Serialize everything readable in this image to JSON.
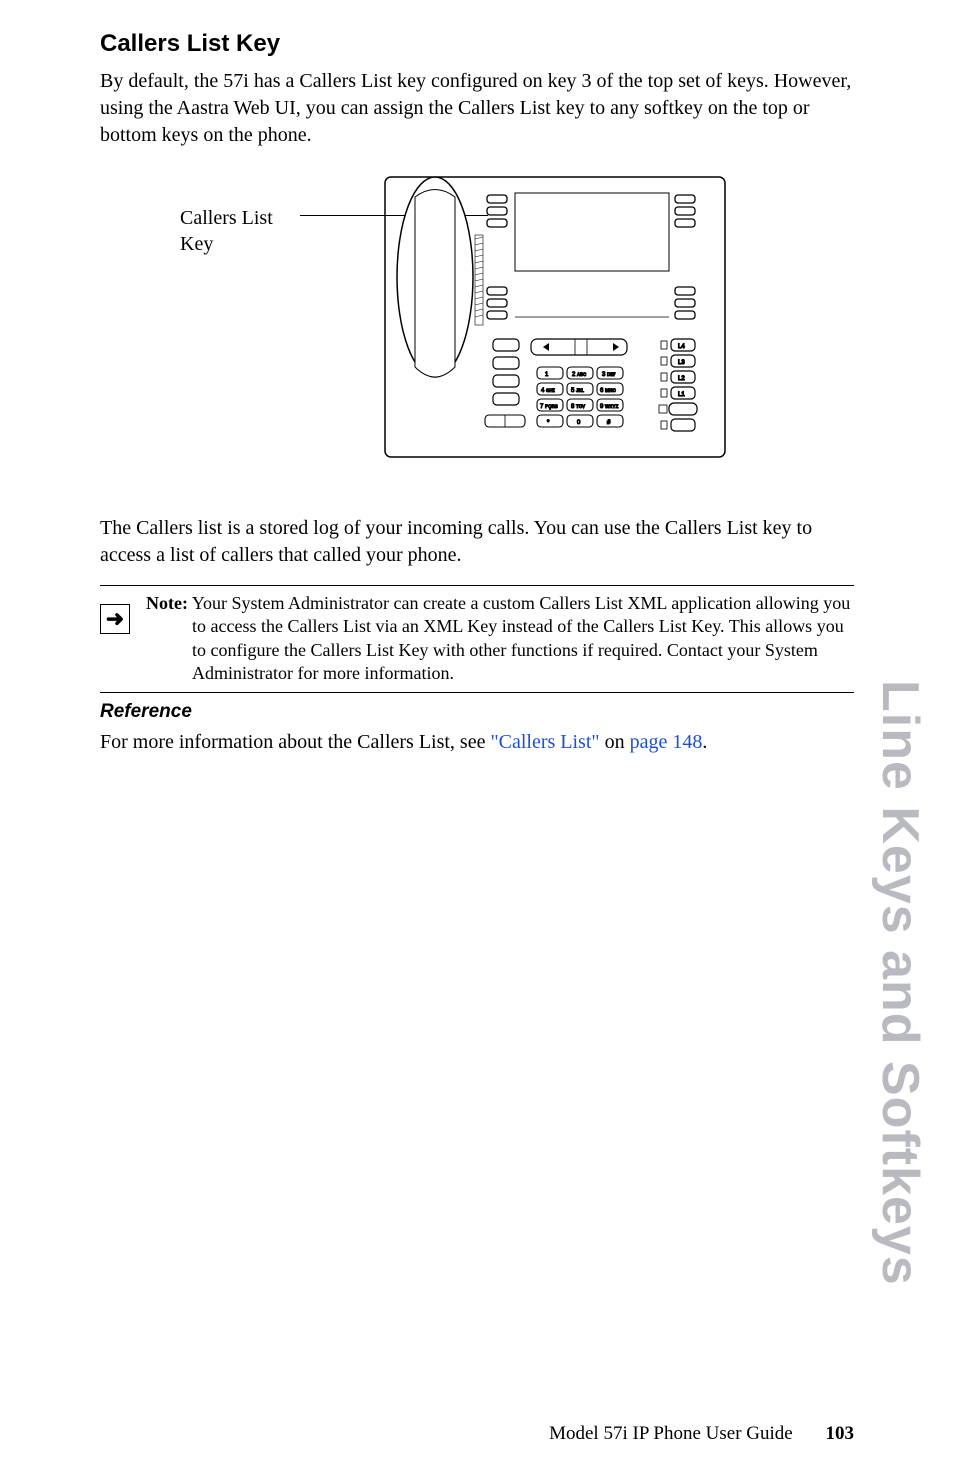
{
  "heading": "Callers List Key",
  "intro": "By default, the 57i has a Callers List key configured on key 3 of the top set of keys. However, using the Aastra Web UI, you can assign the Callers List key to any softkey on the top or bottom keys on the phone.",
  "callout": {
    "line1": "Callers List",
    "line2": "Key"
  },
  "after_figure": "The Callers list is a stored log of your incoming calls. You can use the Callers List key to access a list of callers that called your phone.",
  "note": {
    "label": "Note:",
    "text": " Your System Administrator can create a custom Callers List XML application allowing you to access the Callers List via an XML Key instead of the Callers List Key. This allows you to configure the Callers List Key with other functions if required. Contact your System Administrator for more information."
  },
  "reference_heading": "Reference",
  "reference_text_pre": "For more information about the Callers List, see ",
  "reference_link1": "\"Callers List\"",
  "reference_mid": " on ",
  "reference_link2": "page 148",
  "reference_post": ".",
  "side_title": "Line Keys and Softkeys",
  "footer": {
    "text": "Model 57i IP Phone User Guide",
    "page": "103"
  }
}
